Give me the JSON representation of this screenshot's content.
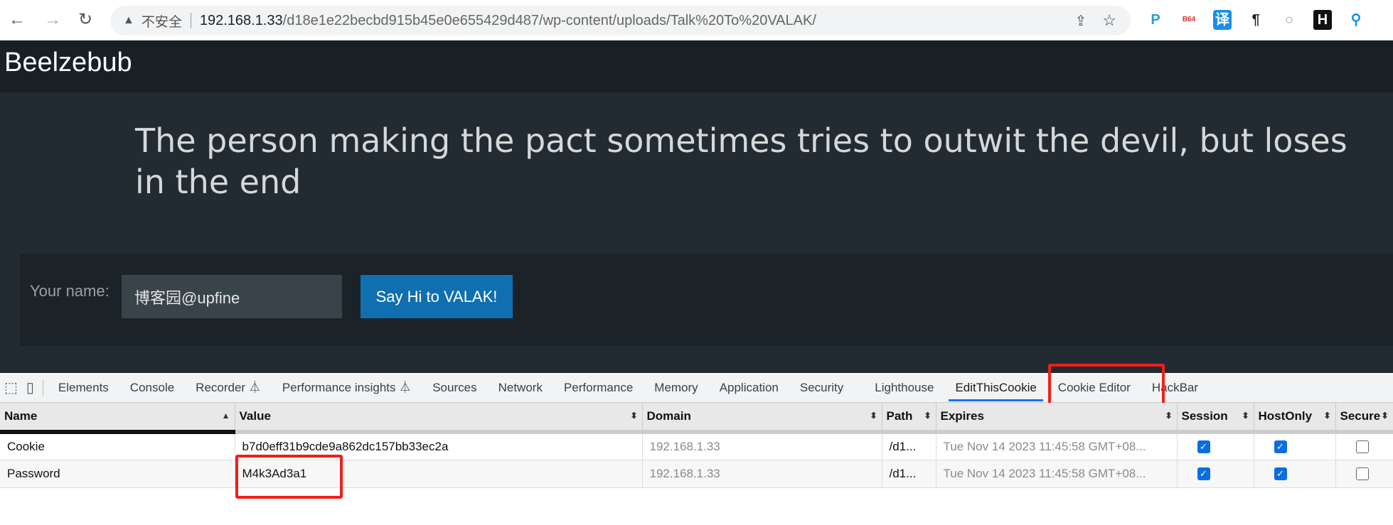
{
  "browser": {
    "back_icon": "arrow-left",
    "forward_icon": "arrow-right",
    "reload_icon": "reload",
    "security_label": "不安全",
    "url_host": "192.168.1.33",
    "url_path": "/d18e1e22becbd915b45e0e655429d487/wp-content/uploads/Talk%20To%20VALAK/",
    "extensions": [
      {
        "name": "p-extension",
        "glyph": "P",
        "color": "#2a9fd8"
      },
      {
        "name": "base64-extension",
        "glyph": "B64",
        "color": "#e03030"
      },
      {
        "name": "translate-extension",
        "glyph": "译",
        "color": "#ffffff"
      },
      {
        "name": "pilcrow-extension",
        "glyph": "¶",
        "color": "#222222"
      },
      {
        "name": "circle-extension",
        "glyph": "○",
        "color": "#999999"
      },
      {
        "name": "h-extension",
        "glyph": "H",
        "color": "#ffffff"
      },
      {
        "name": "pin-extension",
        "glyph": "⚲",
        "color": "#1a8fe8"
      }
    ]
  },
  "page": {
    "brand": "Beelzebub",
    "headline": "The person making the pact sometimes tries to outwit the devil, but loses in the end",
    "form": {
      "name_label": "Your name:",
      "name_value": "博客园@upfine",
      "submit_label": "Say Hi to VALAK!"
    }
  },
  "devtools": {
    "tabs": [
      {
        "label": "Elements"
      },
      {
        "label": "Console"
      },
      {
        "label": "Recorder ⏃"
      },
      {
        "label": "Performance insights ⏃"
      },
      {
        "label": "Sources"
      },
      {
        "label": "Network"
      },
      {
        "label": "Performance"
      },
      {
        "label": "Memory"
      },
      {
        "label": "Application"
      },
      {
        "label": "Security"
      },
      {
        "label": "Lighthouse"
      },
      {
        "label": "EditThisCookie",
        "active": true
      },
      {
        "label": "Cookie Editor"
      },
      {
        "label": "HackBar"
      }
    ],
    "columns": [
      "Name",
      "Value",
      "Domain",
      "Path",
      "Expires",
      "Session",
      "HostOnly",
      "Secure"
    ],
    "rows": [
      {
        "name": "Cookie",
        "value": "b7d0eff31b9cde9a862dc157bb33ec2a",
        "domain": "192.168.1.33",
        "path": "/d1...",
        "expires": "Tue Nov 14 2023 11:45:58 GMT+08...",
        "session": true,
        "hostonly": true,
        "secure": false
      },
      {
        "name": "Password",
        "value": "M4k3Ad3a1",
        "domain": "192.168.1.33",
        "path": "/d1...",
        "expires": "Tue Nov 14 2023 11:45:58 GMT+08...",
        "session": true,
        "hostonly": true,
        "secure": false
      }
    ]
  },
  "highlight_color": "#f0201a"
}
